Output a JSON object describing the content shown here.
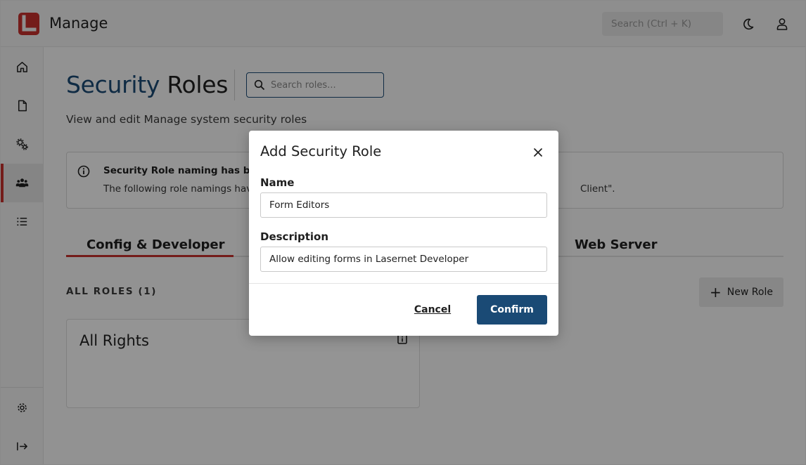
{
  "header": {
    "app_title": "Manage",
    "search_placeholder": "Search (Ctrl + K)",
    "theme_icon": "moon-icon",
    "user_icon": "user-icon"
  },
  "sidebar": {
    "items": [
      {
        "icon": "home-icon"
      },
      {
        "icon": "document-icon"
      },
      {
        "icon": "gears-icon"
      },
      {
        "icon": "users-icon",
        "active": true
      },
      {
        "icon": "list-icon"
      }
    ],
    "bottom": [
      {
        "icon": "settings-icon"
      },
      {
        "icon": "collapse-icon"
      }
    ]
  },
  "main": {
    "title_part1": "Security",
    "title_part2": "Roles",
    "search_placeholder": "Search roles...",
    "subtitle": "View and edit Manage system security roles",
    "notice": {
      "title": "Security Role naming has been",
      "body": "The following role namings have",
      "tail": "Client\"."
    },
    "tabs": [
      {
        "label": "Config & Developer",
        "active": true
      },
      {
        "label": "Web Server"
      }
    ],
    "roles_label": "ALL ROLES (1)",
    "new_role_label": "New Role",
    "roles": [
      {
        "name": "All Rights"
      }
    ]
  },
  "modal": {
    "title": "Add Security Role",
    "name_label": "Name",
    "name_value": "Form Editors",
    "description_label": "Description",
    "description_value": "Allow editing forms in Lasernet Developer",
    "cancel_label": "Cancel",
    "confirm_label": "Confirm"
  },
  "colors": {
    "brand_red": "#c8312d",
    "primary_blue": "#1a4a75"
  }
}
